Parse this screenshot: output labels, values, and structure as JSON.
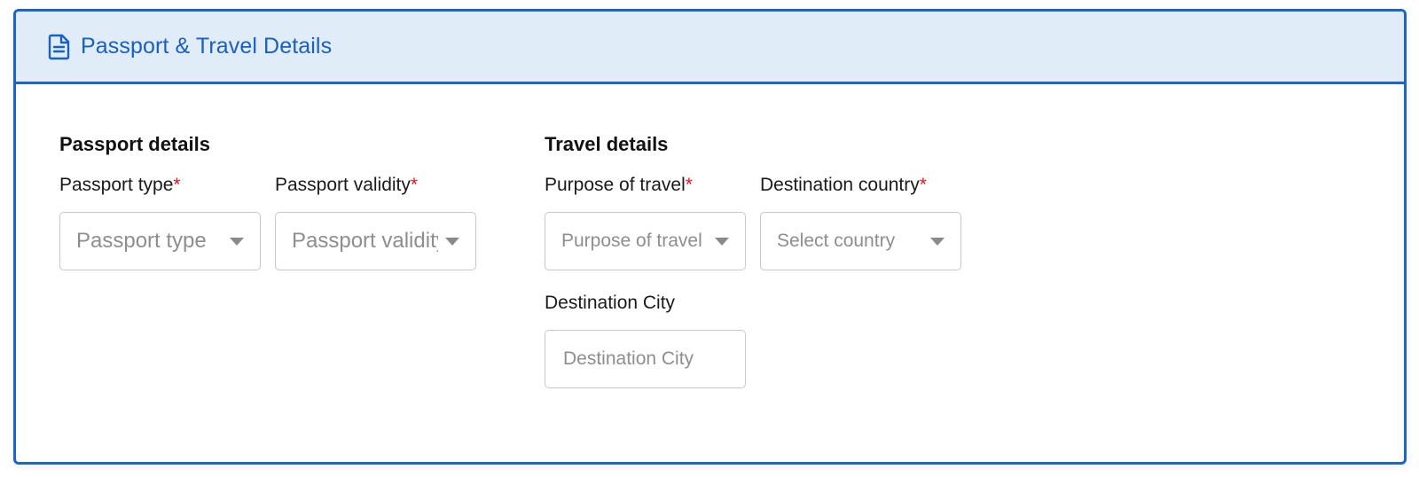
{
  "panel": {
    "title": "Passport & Travel Details",
    "icon": "document-icon",
    "accent_color": "#1e63c8",
    "header_bg": "#e0ecf8",
    "required_marker": "*",
    "required_color": "#e0141e"
  },
  "passport": {
    "heading": "Passport details",
    "type": {
      "label": "Passport type",
      "placeholder": "Passport type"
    },
    "validity": {
      "label": "Passport validity",
      "placeholder": "Passport validity"
    }
  },
  "travel": {
    "heading": "Travel details",
    "purpose": {
      "label": "Purpose of travel",
      "placeholder": "Purpose of travel"
    },
    "country": {
      "label": "Destination country",
      "placeholder": "Select country"
    },
    "city": {
      "label": "Destination City",
      "placeholder": "Destination City",
      "value": ""
    }
  }
}
